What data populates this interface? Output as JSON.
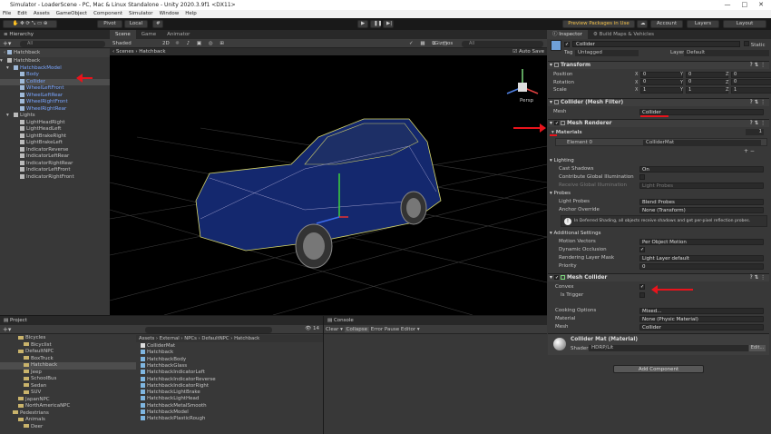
{
  "window": {
    "title": "Simulator - LoaderScene - PC, Mac & Linux Standalone - Unity 2020.3.9f1 <DX11>",
    "controls": [
      "—",
      "□",
      "✕"
    ]
  },
  "menu": [
    "File",
    "Edit",
    "Assets",
    "GameObject",
    "Component",
    "Simulator",
    "Window",
    "Help"
  ],
  "toolbar": {
    "pivot": "Pivot",
    "local": "Local",
    "play": "▶",
    "pause": "❚❚",
    "step": "▶|",
    "preview_packages": "Preview Packages in Use",
    "account": "Account",
    "layers": "Layers",
    "layout": "Layout"
  },
  "hierarchy": {
    "title": "Hierarchy",
    "search_placeholder": "All",
    "root": "Hatchback",
    "items": [
      {
        "label": "Hatchback",
        "depth": 0,
        "color": "white"
      },
      {
        "label": "HatchbackModel",
        "depth": 1,
        "color": "blue"
      },
      {
        "label": "Body",
        "depth": 2,
        "color": "blue"
      },
      {
        "label": "Collider",
        "depth": 2,
        "color": "blue",
        "selected": true
      },
      {
        "label": "WheelLeftFront",
        "depth": 2,
        "color": "blue"
      },
      {
        "label": "WheelLeftRear",
        "depth": 2,
        "color": "blue"
      },
      {
        "label": "WheelRightFront",
        "depth": 2,
        "color": "blue"
      },
      {
        "label": "WheelRightRear",
        "depth": 2,
        "color": "blue"
      },
      {
        "label": "Lights",
        "depth": 1,
        "color": "white"
      },
      {
        "label": "LightHeadRight",
        "depth": 2,
        "color": "white"
      },
      {
        "label": "LightHeadLeft",
        "depth": 2,
        "color": "white"
      },
      {
        "label": "LightBrakeRight",
        "depth": 2,
        "color": "white"
      },
      {
        "label": "LightBrakeLeft",
        "depth": 2,
        "color": "white"
      },
      {
        "label": "IndicatorReverse",
        "depth": 2,
        "color": "white"
      },
      {
        "label": "IndicatorLeftRear",
        "depth": 2,
        "color": "white"
      },
      {
        "label": "IndicatorRightRear",
        "depth": 2,
        "color": "white"
      },
      {
        "label": "IndicatorLeftFront",
        "depth": 2,
        "color": "white"
      },
      {
        "label": "IndicatorRightFront",
        "depth": 2,
        "color": "white"
      }
    ]
  },
  "scene": {
    "tabs": [
      "Scene",
      "Game",
      "Animator"
    ],
    "shading": "Shaded",
    "mode": "2D",
    "gizmos": "Gizmos",
    "search_placeholder": "All",
    "breadcrumb": [
      "Scenes",
      "Hatchback"
    ],
    "auto_save": "Auto Save",
    "persp": "Persp"
  },
  "project": {
    "title": "Project",
    "tree": [
      {
        "label": "Bicycles",
        "depth": 1
      },
      {
        "label": "Bicyclist",
        "depth": 2
      },
      {
        "label": "DefaultNPC",
        "depth": 1
      },
      {
        "label": "BoxTruck",
        "depth": 2
      },
      {
        "label": "Hatchback",
        "depth": 2,
        "selected": true
      },
      {
        "label": "Jeep",
        "depth": 2
      },
      {
        "label": "SchoolBus",
        "depth": 2
      },
      {
        "label": "Sedan",
        "depth": 2
      },
      {
        "label": "SUV",
        "depth": 2
      },
      {
        "label": "JapanNPC",
        "depth": 1
      },
      {
        "label": "NorthAmericaNPC",
        "depth": 1
      },
      {
        "label": "Pedestrians",
        "depth": 0
      },
      {
        "label": "Animals",
        "depth": 1
      },
      {
        "label": "Deer",
        "depth": 2
      }
    ],
    "path": [
      "Assets",
      "External",
      "NPCs",
      "DefaultNPC",
      "Hatchback"
    ],
    "files": [
      "ColliderMat",
      "Hatchback",
      "HatchbackBody",
      "HatchbackGlass",
      "HatchbackIndicatorLeft",
      "HatchbackIndicatorReverse",
      "HatchbackIndicatorRight",
      "HatchbackLightBrake",
      "HatchbackLightHead",
      "HatchbackMetalSmooth",
      "HatchbackModel",
      "HatchbackPlasticRough"
    ],
    "count": "14"
  },
  "console": {
    "title": "Console",
    "buttons": [
      "Clear",
      "Collapse",
      "Error Pause",
      "Editor"
    ]
  },
  "inspector": {
    "tabs": [
      "Inspector",
      "Build Maps & Vehicles"
    ],
    "object_name": "Collider",
    "static": "Static",
    "tag_label": "Tag",
    "tag": "Untagged",
    "layer_label": "Layer",
    "layer": "Default",
    "transform": {
      "title": "Transform",
      "rows": [
        {
          "label": "Position",
          "x": "0",
          "y": "0",
          "z": "0"
        },
        {
          "label": "Rotation",
          "x": "0",
          "y": "0",
          "z": "0"
        },
        {
          "label": "Scale",
          "x": "1",
          "y": "1",
          "z": "1"
        }
      ]
    },
    "mesh_filter": {
      "title": "Collider (Mesh Filter)",
      "mesh_label": "Mesh",
      "mesh": "Collider"
    },
    "mesh_renderer": {
      "title": "Mesh Renderer",
      "materials_label": "Materials",
      "materials_count": "1",
      "element0_label": "Element 0",
      "element0": "ColliderMat",
      "lighting": "Lighting",
      "cast_shadows_label": "Cast Shadows",
      "cast_shadows": "On",
      "contribute_gi": "Contribute Global Illumination",
      "receive_gi_label": "Receive Global Illumination",
      "receive_gi": "Light Probes",
      "probes": "Probes",
      "light_probes_label": "Light Probes",
      "light_probes": "Blend Probes",
      "anchor_override_label": "Anchor Override",
      "anchor_override": "None (Transform)",
      "info": "In Deferred Shading, all objects receive shadows and get per-pixel reflection probes.",
      "additional": "Additional Settings",
      "motion_vectors_label": "Motion Vectors",
      "motion_vectors": "Per Object Motion",
      "dynamic_occlusion_label": "Dynamic Occlusion",
      "rendering_layer_label": "Rendering Layer Mask",
      "rendering_layer": "Light Layer default",
      "priority_label": "Priority",
      "priority": "0"
    },
    "mesh_collider": {
      "title": "Mesh Collider",
      "convex_label": "Convex",
      "is_trigger_label": "Is Trigger",
      "cooking_label": "Cooking Options",
      "cooking": "Mixed...",
      "material_label": "Material",
      "material": "None (Physic Material)",
      "mesh_label": "Mesh",
      "mesh": "Collider"
    },
    "material": {
      "title": "Collider Mat (Material)",
      "shader_label": "Shader",
      "shader": "HDRP/Lit",
      "edit": "Edit..."
    },
    "add_component": "Add Component"
  }
}
